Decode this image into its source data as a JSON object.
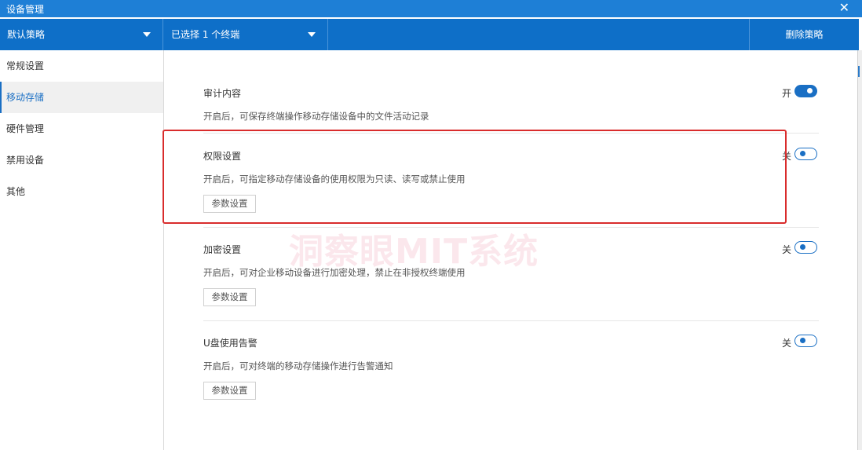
{
  "window": {
    "title": "设备管理",
    "close_glyph": "✕"
  },
  "toolbar": {
    "policy_select": "默认策略",
    "terminal_select": "已选择 1 个终端",
    "delete_label": "删除策略"
  },
  "sidebar": {
    "items": [
      {
        "label": "常规设置",
        "active": false
      },
      {
        "label": "移动存储",
        "active": true
      },
      {
        "label": "硬件管理",
        "active": false
      },
      {
        "label": "禁用设备",
        "active": false
      },
      {
        "label": "其他",
        "active": false
      }
    ]
  },
  "sections": [
    {
      "name": "审计内容",
      "desc": "开启后，可保存终端操作移动存储设备中的文件活动记录",
      "state_label": "开",
      "enabled": true,
      "button": ""
    },
    {
      "name": "权限设置",
      "desc": "开启后，可指定移动存储设备的使用权限为只读、读写或禁止使用",
      "state_label": "关",
      "enabled": false,
      "button": "参数设置"
    },
    {
      "name": "加密设置",
      "desc": "开启后，可对企业移动设备进行加密处理，禁止在非授权终端使用",
      "state_label": "关",
      "enabled": false,
      "button": "参数设置"
    },
    {
      "name": "U盘使用告警",
      "desc": "开启后，可对终端的移动存储操作进行告警通知",
      "state_label": "关",
      "enabled": false,
      "button": "参数设置"
    }
  ],
  "watermark": "洞察眼MIT系统",
  "colors": {
    "accent": "#0e6fc8",
    "titlebar": "#1e7fd6",
    "highlight": "#d92c2c"
  }
}
